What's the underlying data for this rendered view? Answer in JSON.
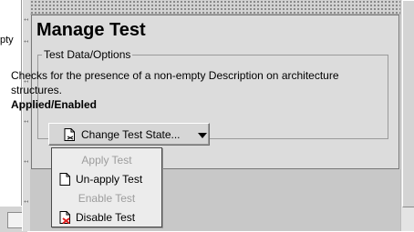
{
  "left_pane": {
    "visible_text": "pty"
  },
  "panel": {
    "title": "Manage Test",
    "group": {
      "legend": "Test Data/Options",
      "description": "Checks for the presence of a non-empty Description on architecture structures.",
      "status": "Applied/Enabled"
    },
    "dropdown": {
      "label": "Change Test State...",
      "icon": "document-icon",
      "arrow": "chevron-down-icon"
    }
  },
  "menu": {
    "items": [
      {
        "label": "Apply Test",
        "enabled": false,
        "icon": ""
      },
      {
        "label": "Un-apply Test",
        "enabled": true,
        "icon": "document-icon"
      },
      {
        "label": "Enable Test",
        "enabled": false,
        "icon": ""
      },
      {
        "label": "Disable Test",
        "enabled": true,
        "icon": "document-x-icon"
      }
    ]
  },
  "colors": {
    "panel_bg": "#dcdcdc",
    "disabled_text": "#9d9d9d",
    "disable_icon_x": "#e02020"
  }
}
